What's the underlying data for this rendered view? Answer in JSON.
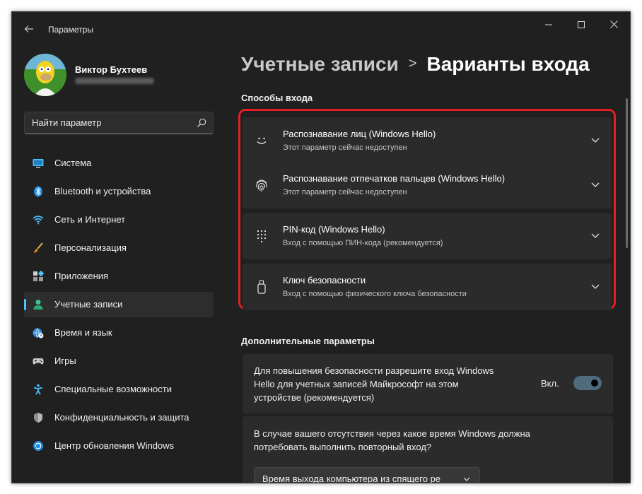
{
  "window": {
    "title": "Параметры",
    "controls": [
      "minimize",
      "maximize",
      "close"
    ]
  },
  "profile": {
    "name": "Виктор Бухтеев",
    "email": ""
  },
  "search": {
    "placeholder": "Найти параметр"
  },
  "sidebar": {
    "items": [
      {
        "label": "Система",
        "icon": "monitor-icon",
        "active": false
      },
      {
        "label": "Bluetooth и устройства",
        "icon": "bluetooth-icon",
        "active": false
      },
      {
        "label": "Сеть и Интернет",
        "icon": "wifi-icon",
        "active": false
      },
      {
        "label": "Персонализация",
        "icon": "brush-icon",
        "active": false
      },
      {
        "label": "Приложения",
        "icon": "apps-icon",
        "active": false
      },
      {
        "label": "Учетные записи",
        "icon": "person-icon",
        "active": true
      },
      {
        "label": "Время и язык",
        "icon": "globe-clock-icon",
        "active": false
      },
      {
        "label": "Игры",
        "icon": "gamepad-icon",
        "active": false
      },
      {
        "label": "Специальные возможности",
        "icon": "accessibility-icon",
        "active": false
      },
      {
        "label": "Конфиденциальность и защита",
        "icon": "shield-icon",
        "active": false
      },
      {
        "label": "Центр обновления Windows",
        "icon": "update-icon",
        "active": false
      }
    ]
  },
  "breadcrumb": {
    "parent": "Учетные записи",
    "separator": ">",
    "current": "Варианты входа"
  },
  "sign_in": {
    "section_title": "Способы входа",
    "options": [
      {
        "title": "Распознавание лиц (Windows Hello)",
        "subtitle": "Этот параметр сейчас недоступен",
        "icon": "face-icon"
      },
      {
        "title": "Распознавание отпечатков пальцев (Windows Hello)",
        "subtitle": "Этот параметр сейчас недоступен",
        "icon": "fingerprint-icon"
      },
      {
        "title": "PIN-код (Windows Hello)",
        "subtitle": "Вход с помощью ПИН-кода (рекомендуется)",
        "icon": "pin-keypad-icon"
      },
      {
        "title": "Ключ безопасности",
        "subtitle": "Вход с помощью физического ключа безопасности",
        "icon": "usb-key-icon"
      }
    ]
  },
  "additional": {
    "section_title": "Дополнительные параметры",
    "hello_only": {
      "text": "Для повышения безопасности разрешите вход Windows Hello для учетных записей Майкрософт на этом устройстве (рекомендуется)",
      "toggle_label": "Вкл.",
      "toggle_on": true
    },
    "require_signin": {
      "text": "В случае вашего отсутствия через какое время Windows должна потребовать выполнить повторный вход?",
      "dropdown_value": "Время выхода компьютера из спящего ре"
    }
  },
  "colors": {
    "background": "#202020",
    "card": "#2b2b2b",
    "accent": "#4cc2ff",
    "highlight_frame": "#e51e25"
  }
}
